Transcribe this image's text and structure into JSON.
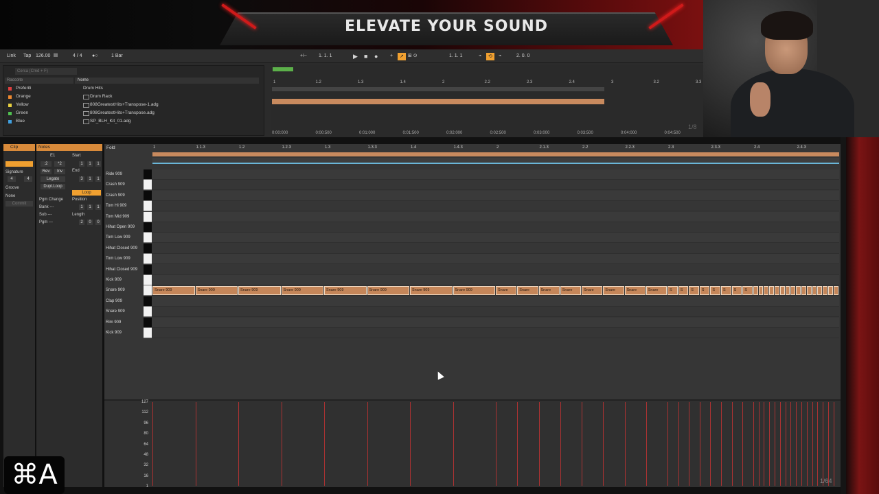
{
  "banner": {
    "title": "ELEVATE YOUR SOUND"
  },
  "transport": {
    "link": "Link",
    "tap": "Tap",
    "tempo": "126.00",
    "signature": "4 / 4",
    "quantize": "1 Bar",
    "position": "1.   1.   1",
    "loop_start": "1.   1.   1",
    "loop_length": "2.   0.   0"
  },
  "browser": {
    "search_placeholder": "Cerca (Cmd + F)",
    "collections_header": "Raccolte",
    "collections": [
      {
        "label": "Preferiti",
        "color": "#e04040"
      },
      {
        "label": "Orange",
        "color": "#f08a30"
      },
      {
        "label": "Yellow",
        "color": "#e8d040"
      },
      {
        "label": "Green",
        "color": "#50c050"
      },
      {
        "label": "Blue",
        "color": "#40a0e0"
      }
    ],
    "name_header": "Nome",
    "files": [
      "Drum Hits",
      "Drum Rack",
      "808GreatestHits+Transpose-1.adg",
      "808GreatestHits+Transpose.adg",
      "SP_BLH_Kit_01.adg"
    ]
  },
  "overview": {
    "ruler": [
      "1",
      "1.2",
      "1.3",
      "1.4",
      "2",
      "2.2",
      "2.3",
      "2.4",
      "3",
      "3.2",
      "3.3"
    ],
    "times": [
      "0:00:000",
      "0:00:500",
      "0:01:000",
      "0:01:500",
      "0:02:000",
      "0:02:500",
      "0:03:000",
      "0:03:500",
      "0:04:000",
      "0:04:500"
    ],
    "grid_ratio": "1/8"
  },
  "clip": {
    "clip_tab": "Clip",
    "notes_tab": "Notes",
    "signature_label": "Signature",
    "sig_num": "4",
    "sig_den": "4",
    "groove_label": "Groove",
    "groove_value": "None",
    "commit": "Commit",
    "key": "E1",
    "div2": ":2",
    "mul2": "*2",
    "rev": "Rev",
    "inv": "Inv",
    "legato": "Legato",
    "dupl_loop": "Dupl.Loop",
    "pgm_change": "Pgm Change",
    "bank": "Bank ---",
    "sub": "Sub ---",
    "pgm": "Pgm ---",
    "start_label": "Start",
    "start": [
      "1",
      "1",
      "1"
    ],
    "end_label": "End",
    "end": [
      "3",
      "1",
      "1"
    ],
    "loop": "Loop",
    "position_label": "Position",
    "position": [
      "1",
      "1",
      "1"
    ],
    "length_label": "Length",
    "length": [
      "2",
      "0",
      "0"
    ]
  },
  "roll": {
    "fold": "Fold",
    "ruler": [
      "1",
      "1.1.3",
      "1.2",
      "1.2.3",
      "1.3",
      "1.3.3",
      "1.4",
      "1.4.3",
      "2",
      "2.1.3",
      "2.2",
      "2.2.3",
      "2.3",
      "2.3.3",
      "2.4",
      "2.4.3"
    ],
    "lanes": [
      {
        "name": "Ride 909",
        "black": true
      },
      {
        "name": "Crash 909",
        "black": false
      },
      {
        "name": "Crash 909",
        "black": true
      },
      {
        "name": "Tom Hi 909",
        "black": false
      },
      {
        "name": "Tom Mid 909",
        "black": false
      },
      {
        "name": "Hihat Open 909",
        "black": true
      },
      {
        "name": "Tom Low 909",
        "black": false
      },
      {
        "name": "Hihat Closed 909",
        "black": true
      },
      {
        "name": "Tom Low 909",
        "black": false
      },
      {
        "name": "Hihat Closed 909",
        "black": true
      },
      {
        "name": "Kick 909",
        "black": false
      },
      {
        "name": "Snare 909",
        "black": false
      },
      {
        "name": "Clap 909",
        "black": true
      },
      {
        "name": "Snare 909",
        "black": false
      },
      {
        "name": "Rim 909",
        "black": true
      },
      {
        "name": "Kick 909",
        "black": false
      }
    ],
    "note_label_long": "Snare 909",
    "note_label_mid": "Snare",
    "note_label_short": "S",
    "note_count_long": 8,
    "note_count_mid": 8,
    "note_count_short": 8,
    "note_count_tiny": 16
  },
  "velocity": {
    "ticks": [
      "127",
      "112",
      "96",
      "80",
      "64",
      "48",
      "32",
      "16",
      "1"
    ],
    "grid_ratio": "1/64"
  },
  "overlay": {
    "shortcut": "⌘A"
  },
  "colors": {
    "accent": "#f0a030",
    "note": "#c58659",
    "velocity": "#cc3333"
  }
}
